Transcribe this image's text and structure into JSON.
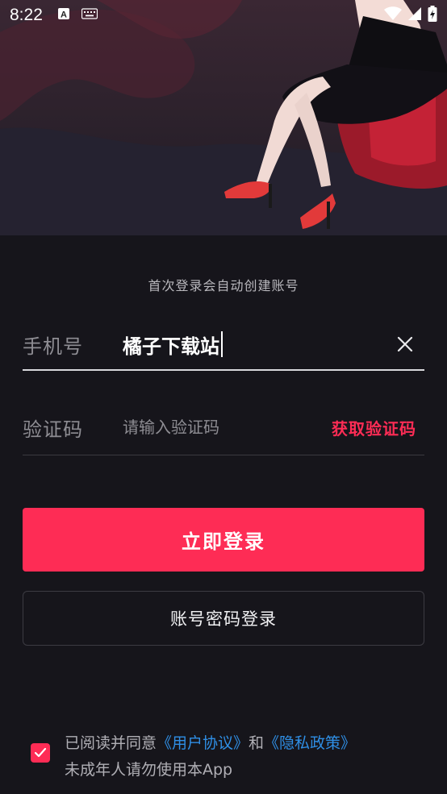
{
  "status_bar": {
    "time": "8:22",
    "icons": [
      "font-icon",
      "keyboard-icon",
      "wifi-icon",
      "signal-icon",
      "battery-charging-icon"
    ]
  },
  "hint": "首次登录会自动创建账号",
  "phone": {
    "label": "手机号",
    "value": "橘子下载站"
  },
  "code": {
    "label": "验证码",
    "placeholder": "请输入验证码",
    "get_code": "获取验证码"
  },
  "buttons": {
    "login": "立即登录",
    "password_login": "账号密码登录"
  },
  "agreement": {
    "prefix": "已阅读并同意",
    "user_agreement": "《用户协议》",
    "and": "和",
    "privacy_policy": "《隐私政策》",
    "minor_notice": "未成年人请勿使用本App",
    "checked": true
  },
  "colors": {
    "accent": "#fe2c55",
    "link": "#2f8fe6",
    "background": "#16151b"
  }
}
